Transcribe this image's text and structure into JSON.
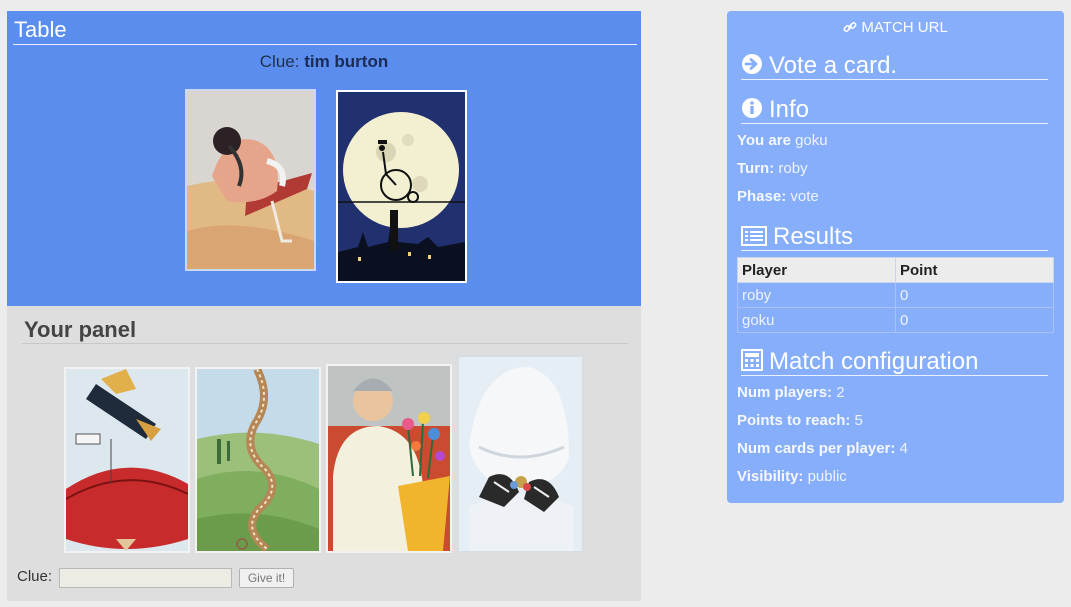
{
  "table": {
    "title": "Table",
    "clue_label": "Clue:",
    "clue_value": "tim burton",
    "cards": [
      {
        "name": "table-card-1",
        "description": "sleeping figure on red sled in desert"
      },
      {
        "name": "table-card-2",
        "description": "figure on penny-farthing bicycle over full moon"
      }
    ]
  },
  "panel": {
    "title": "Your panel",
    "clue_label": "Clue:",
    "clue_input_value": "",
    "clue_input_placeholder": "",
    "give_button_label": "Give it!"
  },
  "sidebar": {
    "match_url_label": "MATCH URL",
    "vote_heading": "Vote a card.",
    "info_heading": "Info",
    "info": {
      "you_are_label": "You are",
      "you_are_value": "goku",
      "turn_label": "Turn:",
      "turn_value": "roby",
      "phase_label": "Phase:",
      "phase_value": "vote"
    },
    "results_heading": "Results",
    "results": {
      "columns": [
        "Player",
        "Point"
      ],
      "rows": [
        {
          "player": "roby",
          "point": "0"
        },
        {
          "player": "goku",
          "point": "0"
        }
      ]
    },
    "config_heading": "Match configuration",
    "config": {
      "num_players_label": "Num players:",
      "num_players_value": "2",
      "points_label": "Points to reach:",
      "points_value": "5",
      "cards_label": "Num cards per player:",
      "cards_value": "4",
      "visibility_label": "Visibility:",
      "visibility_value": "public"
    }
  },
  "colors": {
    "table_bg": "#5b8def",
    "panel_bg": "#dedede",
    "sidebar_bg": "#86aefb",
    "page_bg": "#ececec"
  },
  "icons": {
    "match_url": "link-icon",
    "vote": "arrow-circle-right-icon",
    "info": "info-circle-icon",
    "results": "list-icon",
    "config": "calculator-icon"
  }
}
